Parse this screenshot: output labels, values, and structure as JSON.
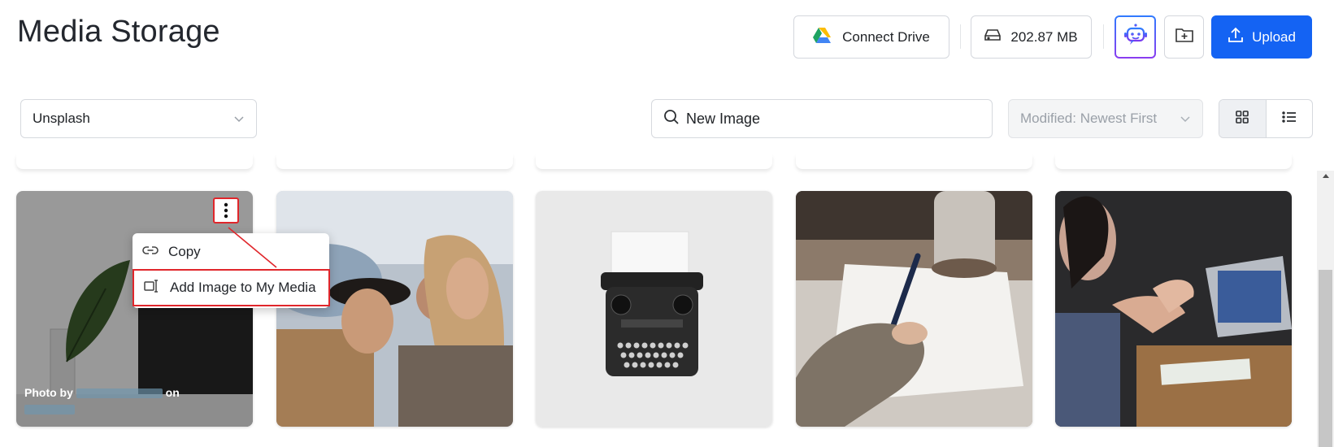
{
  "header": {
    "title": "Media Storage",
    "connect_drive_label": "Connect Drive",
    "storage_used": "202.87 MB",
    "upload_label": "Upload"
  },
  "filters": {
    "source_selected": "Unsplash",
    "search_value": "New Image",
    "sort_selected": "Modified: Newest First"
  },
  "cards": [
    {
      "credit_prefix": "Photo by",
      "credit_suffix": "on"
    }
  ],
  "context_menu": {
    "copy_label": "Copy",
    "add_label": "Add Image to My Media"
  },
  "colors": {
    "accent": "#1463f3",
    "highlight": "#e0262b"
  }
}
